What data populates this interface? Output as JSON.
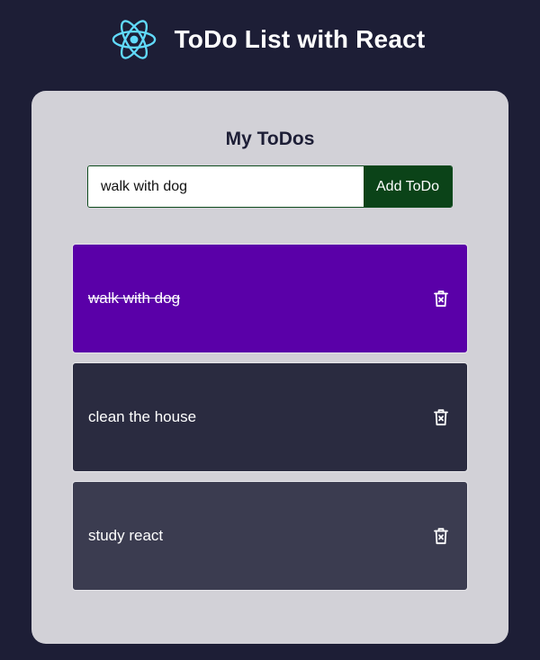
{
  "header": {
    "title": "ToDo List with React",
    "logo_icon": "react-atom-icon",
    "logo_color": "#61dafb"
  },
  "card": {
    "title": "My ToDos",
    "input_value": "walk with dog",
    "add_button_label": "Add ToDo"
  },
  "todos": [
    {
      "text": "walk with dog",
      "completed": true,
      "color": "#5a00a8",
      "delete_icon": "trash-icon"
    },
    {
      "text": "clean the house",
      "completed": false,
      "color": "#2a2b40",
      "delete_icon": "trash-icon"
    },
    {
      "text": "study react",
      "completed": false,
      "color": "#3b3c50",
      "delete_icon": "trash-icon"
    }
  ],
  "colors": {
    "background": "#1d1e36",
    "card": "#d2d1d7",
    "add_button": "#0b4318"
  }
}
